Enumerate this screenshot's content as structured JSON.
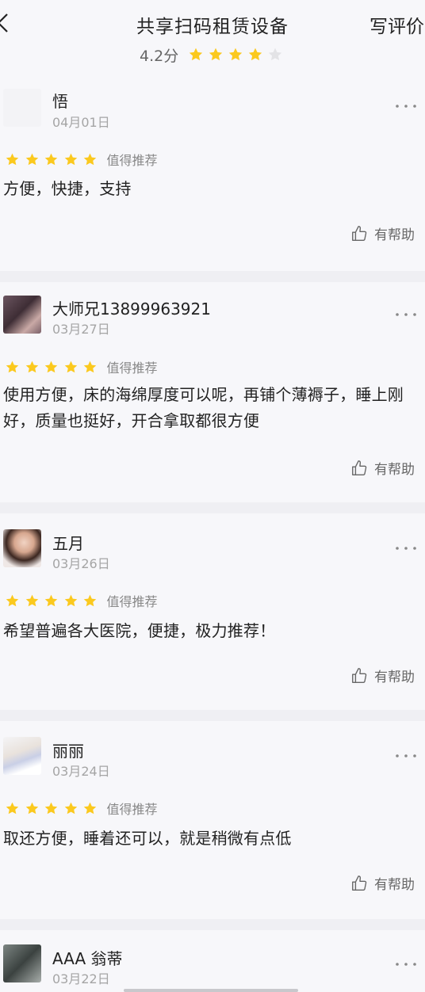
{
  "header": {
    "title": "共享扫码租赁设备",
    "write_review": "写评价",
    "score": "4.2分",
    "stars": 4,
    "stars_total": 5
  },
  "colors": {
    "star": "#fbc91e",
    "star_empty": "#e3e3e6",
    "text": "#222222",
    "muted": "#a5a5a5"
  },
  "reviews": [
    {
      "username": "悟",
      "date": "04月01日",
      "stars": 5,
      "recommend": "值得推荐",
      "content": "方便，快捷，支持",
      "helpful": "有帮助"
    },
    {
      "username": "大师兄13899963921",
      "date": "03月27日",
      "stars": 5,
      "recommend": "值得推荐",
      "content": "使用方便，床的海绵厚度可以呢，再铺个薄褥子，睡上刚好，质量也挺好，开合拿取都很方便",
      "helpful": "有帮助"
    },
    {
      "username": "五月",
      "date": "03月26日",
      "stars": 5,
      "recommend": "值得推荐",
      "content": "希望普遍各大医院，便捷，极力推荐！",
      "helpful": "有帮助"
    },
    {
      "username": "丽丽",
      "date": "03月24日",
      "stars": 5,
      "recommend": "值得推荐",
      "content": "取还方便，睡着还可以，就是稍微有点低",
      "helpful": "有帮助"
    },
    {
      "username": "AAA 翁蒂",
      "date": "03月22日"
    }
  ]
}
